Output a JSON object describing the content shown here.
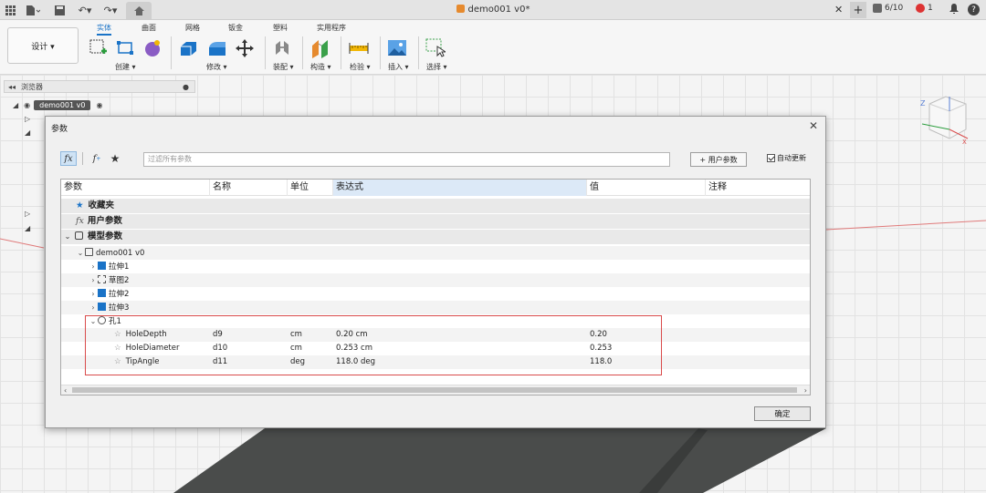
{
  "topbar": {
    "doc_title": "demo001 v0*",
    "jobs": "6/10",
    "notifications": "1",
    "help": "?"
  },
  "ribbon": {
    "workspace": "设计 ▾",
    "tabs": [
      "实体",
      "曲面",
      "网格",
      "钣金",
      "塑料",
      "实用程序"
    ],
    "groups": [
      "创建 ▾",
      "修改 ▾",
      "装配 ▾",
      "构造 ▾",
      "检验 ▾",
      "插入 ▾",
      "选择 ▾"
    ]
  },
  "browser": {
    "label": "浏览器",
    "root": "demo001 v0"
  },
  "dialog": {
    "title": "参数",
    "filter_placeholder": "过滤所有参数",
    "user_param_button": "+ 用户参数",
    "auto_update_label": "自动更新",
    "auto_update_checked": true,
    "ok_label": "确定",
    "columns": [
      "参数",
      "名称",
      "单位",
      "表达式",
      "值",
      "注释"
    ],
    "groups": {
      "favorites": "收藏夹",
      "user_params": "用户参数",
      "model_params": "模型参数"
    },
    "component": "demo001 v0",
    "features": [
      "拉伸1",
      "草图2",
      "拉伸2",
      "拉伸3"
    ],
    "hole": {
      "name": "孔1",
      "params": [
        {
          "param": "HoleDepth",
          "name": "d9",
          "unit": "cm",
          "expr": "0.20 cm",
          "value": "0.20"
        },
        {
          "param": "HoleDiameter",
          "name": "d10",
          "unit": "cm",
          "expr": "0.253 cm",
          "value": "0.253"
        },
        {
          "param": "TipAngle",
          "name": "d11",
          "unit": "deg",
          "expr": "118.0 deg",
          "value": "118.0"
        }
      ]
    }
  },
  "colors": {
    "accent": "#1a73c7",
    "highlight_box": "#d94b4b",
    "selected_header": "#dce9f7"
  }
}
